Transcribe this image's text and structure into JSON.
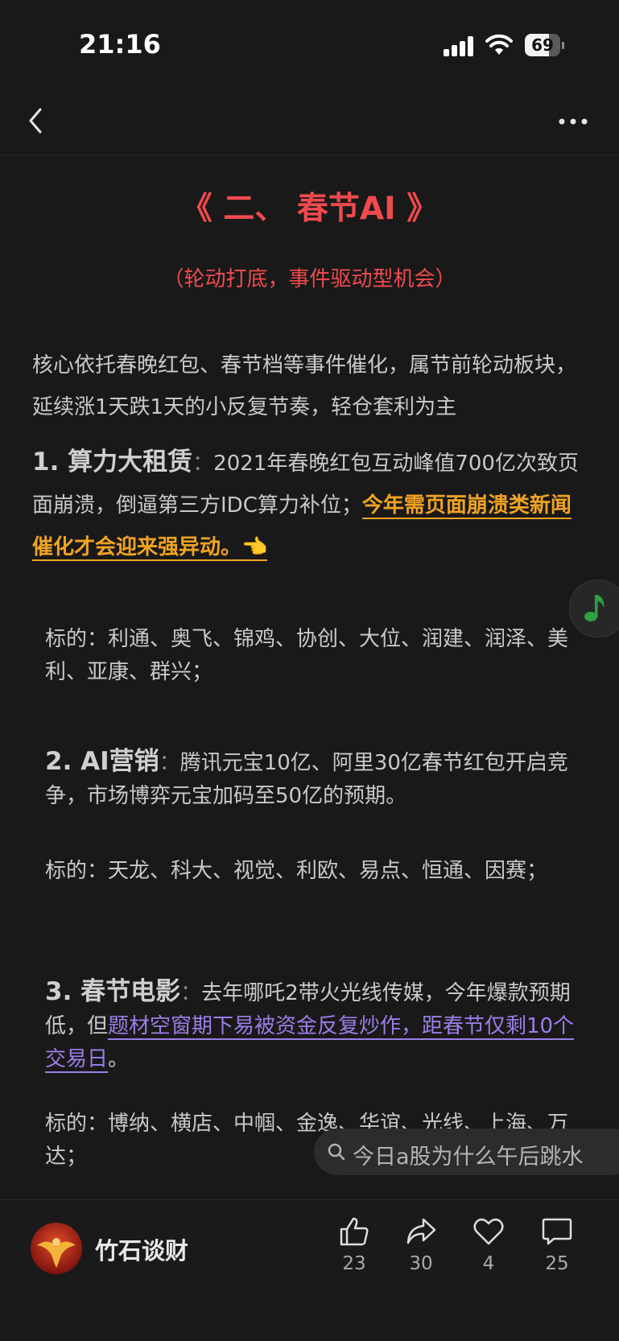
{
  "status_bar": {
    "time": "21:16",
    "battery": "69",
    "battery_level": 0.69
  },
  "article": {
    "title": "《 二、 春节AI 》",
    "subtitle": "（轮动打底，事件驱动型机会）",
    "intro": "核心依托春晚红包、春节档等事件催化，属节前轮动板块，延续涨1天跌1天的小反复节奏，轻仓套利为主",
    "section1": {
      "heading": "1. 算力大租赁",
      "colon": "：",
      "text": "2021年春晚红包互动峰值700亿次致页面崩溃，倒逼第三方IDC算力补位；",
      "highlight": "今年需页面崩溃类新闻催化才会迎来强异动。👈"
    },
    "targets1": "标的：利通、奥飞、锦鸡、协创、大位、润建、润泽、美利、亚康、群兴；",
    "section2": {
      "heading": "2. AI营销",
      "colon": "：",
      "text": "腾讯元宝10亿、阿里30亿春节红包开启竞争，市场博弈元宝加码至50亿的预期。"
    },
    "targets2": "标的：天龙、科大、视觉、利欧、易点、恒通、因赛；",
    "section3": {
      "heading": "3. 春节电影",
      "colon": "：",
      "text": "去年哪吒2带火光线传媒，今年爆款预期低，但",
      "highlight": "题材空窗期下易被资金反复炒作，距春节仅剩10个交易日",
      "end": "。"
    },
    "targets3": "标的：博纳、横店、中帼、金逸、华谊、光线、上海、万达；"
  },
  "search_hint": "今日a股为什么午后跳水",
  "author": {
    "name": "竹石谈财"
  },
  "actions": {
    "like_count": "23",
    "share_count": "30",
    "favorite_count": "4",
    "comment_count": "25"
  },
  "colors": {
    "title_red": "#f04a4e",
    "highlight_orange": "#f0a321",
    "link_purple": "#9a7ee8"
  },
  "icons": [
    "back-icon",
    "more-icon",
    "music-note-icon",
    "search-icon",
    "thumbs-up-icon",
    "share-icon",
    "heart-icon",
    "comment-icon"
  ]
}
